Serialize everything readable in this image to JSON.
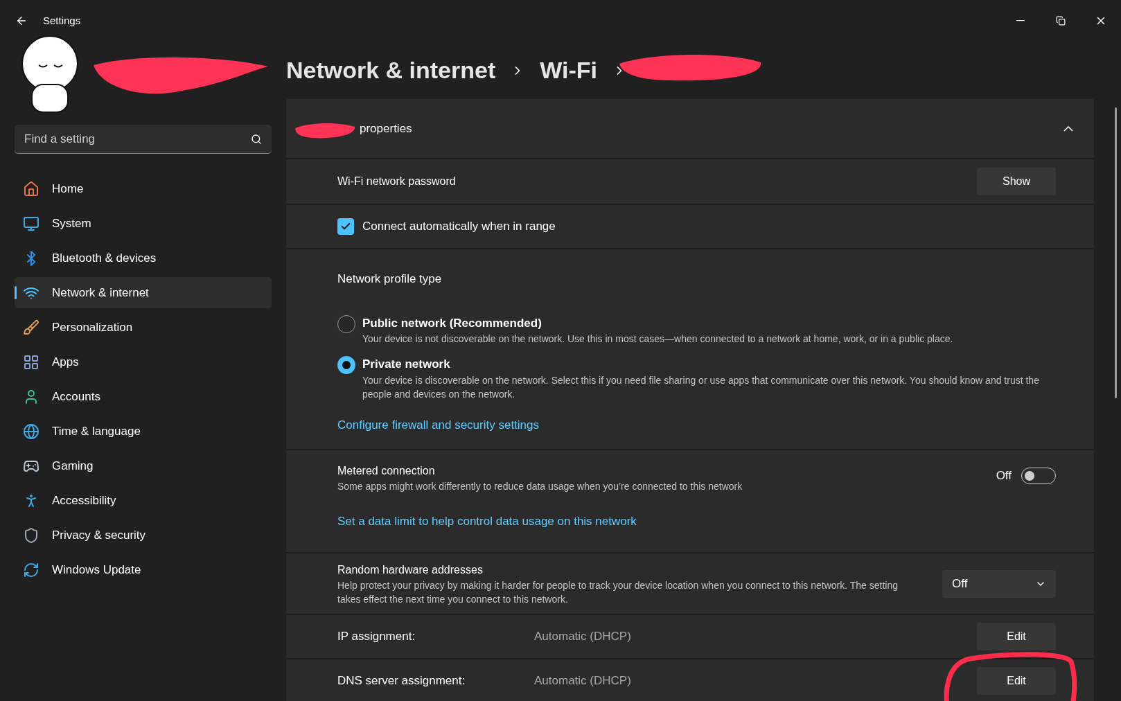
{
  "window": {
    "title": "Settings"
  },
  "search": {
    "placeholder": "Find a setting"
  },
  "sidebar": {
    "items": [
      {
        "label": "Home",
        "selected": false
      },
      {
        "label": "System",
        "selected": false
      },
      {
        "label": "Bluetooth & devices",
        "selected": false
      },
      {
        "label": "Network & internet",
        "selected": true
      },
      {
        "label": "Personalization",
        "selected": false
      },
      {
        "label": "Apps",
        "selected": false
      },
      {
        "label": "Accounts",
        "selected": false
      },
      {
        "label": "Time & language",
        "selected": false
      },
      {
        "label": "Gaming",
        "selected": false
      },
      {
        "label": "Accessibility",
        "selected": false
      },
      {
        "label": "Privacy & security",
        "selected": false
      },
      {
        "label": "Windows Update",
        "selected": false
      }
    ]
  },
  "breadcrumb": [
    "Network & internet",
    "Wi-Fi"
  ],
  "section": {
    "title": "properties",
    "expanded": true
  },
  "rows": [
    {
      "kind": "button",
      "label": "Wi-Fi network password",
      "button": "Show"
    },
    {
      "kind": "checkbox",
      "label": "Connect automatically when in range",
      "checked": true
    },
    {
      "kind": "radios",
      "label": "Network profile type",
      "options": [
        {
          "label": "Public network (Recommended)",
          "description": "Your device is not discoverable on the network. Use this in most cases—when connected to a network at home, work, or in a public place.",
          "selected": false
        },
        {
          "label": "Private network",
          "description": "Your device is discoverable on the network. Select this if you need file sharing or use apps that communicate over this network. You should know and trust the people and devices on the network.",
          "selected": true
        }
      ],
      "link": "Configure firewall and security settings"
    },
    {
      "kind": "toggle",
      "label": "Metered connection",
      "description": "Some apps might work differently to reduce data usage when you’re connected to this network",
      "reading": "Off",
      "on": false,
      "link": "Set a data limit to help control data usage on this network"
    },
    {
      "kind": "dropdown",
      "label": "Random hardware addresses",
      "description": "Help protect your privacy by making it harder for people to track your device location when you connect to this network. The setting takes effect the next time you connect to this network.",
      "value": "Off"
    },
    {
      "kind": "value",
      "label": "IP assignment:",
      "value": "Automatic (DHCP)",
      "button": "Edit"
    },
    {
      "kind": "value",
      "label": "DNS server assignment:",
      "value": "Automatic (DHCP)",
      "button": "Edit",
      "circled": true
    }
  ]
}
